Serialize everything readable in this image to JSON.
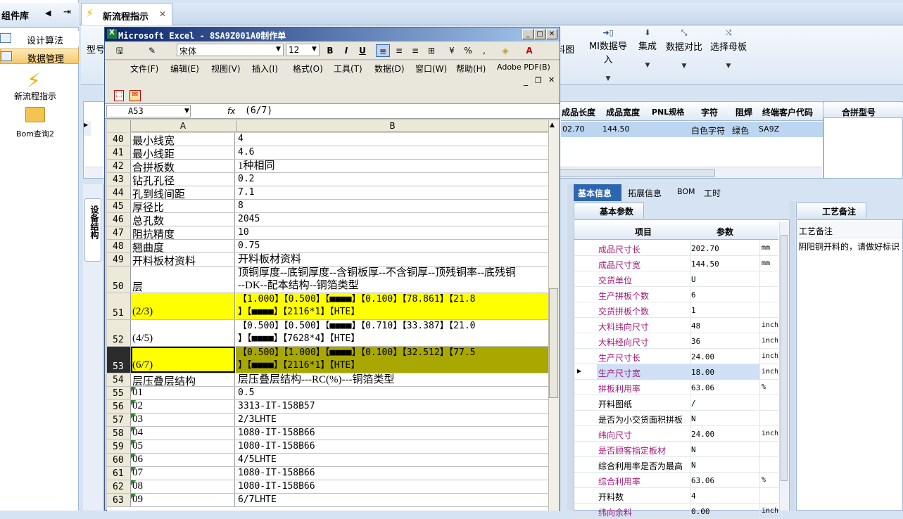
{
  "leftpanel": {
    "title": "组件库",
    "items": [
      "设计算法",
      "数据管理"
    ],
    "big_items": [
      "新流程指示",
      "Bom查询2"
    ]
  },
  "tabs": {
    "active": "新流程指示"
  },
  "ribbon": {
    "left_label": "型号",
    "partial_left": "料图",
    "buttons": [
      "MI数据导入",
      "集成",
      "数据对比",
      "选择母板"
    ]
  },
  "top_grid": {
    "headers": [
      "成品长度",
      "成品宽度",
      "PNL规格",
      "字符",
      "阻焊",
      "终端客户代码",
      "合拼型号"
    ],
    "row": [
      "02.70",
      "144.50",
      "",
      "白色字符",
      "绿色",
      "SA9Z"
    ]
  },
  "side_vtab": "设备结构",
  "right_tabs": [
    "基本信息",
    "拓展信息",
    "BOM",
    "工时"
  ],
  "basic": {
    "tab": "基本参数",
    "headers": [
      "项目",
      "参数"
    ],
    "rows": [
      {
        "name": "成品尺寸长",
        "value": "202.70",
        "unit": "mm"
      },
      {
        "name": "成品尺寸宽",
        "value": "144.50",
        "unit": "mm"
      },
      {
        "name": "交货单位",
        "value": "U",
        "unit": ""
      },
      {
        "name": "生产拼板个数",
        "value": "6",
        "unit": ""
      },
      {
        "name": "交货拼板个数",
        "value": "1",
        "unit": ""
      },
      {
        "name": "大料纬向尺寸",
        "value": "48",
        "unit": "inch"
      },
      {
        "name": "大料经向尺寸",
        "value": "36",
        "unit": "inch"
      },
      {
        "name": "生产尺寸长",
        "value": "24.00",
        "unit": "inch"
      },
      {
        "name": "生产尺寸宽",
        "value": "18.00",
        "unit": "inch"
      },
      {
        "name": "拼板利用率",
        "value": "63.06",
        "unit": "%"
      },
      {
        "name": "开料图纸",
        "value": "/",
        "unit": ""
      },
      {
        "name": "是否为小交货面积拼板",
        "value": "N",
        "unit": ""
      },
      {
        "name": "纬向尺寸",
        "value": "24.00",
        "unit": "inch"
      },
      {
        "name": "是否顾客指定板材",
        "value": "N",
        "unit": ""
      },
      {
        "name": "综合利用率是否为最高",
        "value": "N",
        "unit": ""
      },
      {
        "name": "综合利用率",
        "value": "63.06",
        "unit": "%"
      },
      {
        "name": "开料数",
        "value": "4",
        "unit": ""
      },
      {
        "name": "纬向余料",
        "value": "0.00",
        "unit": "inch"
      }
    ]
  },
  "craft": {
    "tab": "工艺备注",
    "header": "工艺备注",
    "text": "阴阳铜开料的，请做好标识"
  },
  "excel": {
    "title": "Microsoft Excel - 8SA9Z001A0制作单",
    "font": "宋体",
    "size": "12",
    "menu": [
      "文件(F)",
      "编辑(E)",
      "视图(V)",
      "插入(I)",
      "格式(O)",
      "工具(T)",
      "数据(D)",
      "窗口(W)",
      "帮助(H)",
      "Adobe PDF(B)"
    ],
    "namebox": "A53",
    "fx": "fx",
    "formula": "(6/7)",
    "cols": [
      "A",
      "B"
    ],
    "rows": [
      {
        "n": "40",
        "a": "最小线宽",
        "b": "4"
      },
      {
        "n": "41",
        "a": "最小线距",
        "b": "4.6"
      },
      {
        "n": "42",
        "a": "合拼板数",
        "b": "1种相同"
      },
      {
        "n": "43",
        "a": "钻孔孔径",
        "b": "0.2"
      },
      {
        "n": "44",
        "a": "孔到线间距",
        "b": "7.1"
      },
      {
        "n": "45",
        "a": "厚径比",
        "b": "8"
      },
      {
        "n": "46",
        "a": "总孔数",
        "b": "2045"
      },
      {
        "n": "47",
        "a": "阻抗精度",
        "b": "10"
      },
      {
        "n": "48",
        "a": "翘曲度",
        "b": "0.75"
      },
      {
        "n": "49",
        "a": "开料板材资料",
        "b": "开料板材资料"
      },
      {
        "n": "50",
        "a": "层",
        "b": "顶铜厚度--底铜厚度--含铜板厚--不含铜厚--顶残铜率--底残铜\n--DK--配本结构--铜箔类型"
      },
      {
        "n": "51",
        "a": "(2/3)",
        "b": "【1.000】【0.500】【■■■■】【0.100】【78.861】【21.8\n】【■■■■】【2116*1】【HTE】"
      },
      {
        "n": "52",
        "a": "(4/5)",
        "b": "【0.500】【0.500】【■■■■】【0.710】【33.387】【21.0\n】【■■■■】【7628*4】【HTE】"
      },
      {
        "n": "53",
        "a": "(6/7)",
        "b": "【0.500】【1.000】【■■■■】【0.100】【32.512】【77.5\n】【■■■■】【2116*1】【HTE】"
      },
      {
        "n": "54",
        "a": "层压叠层结构",
        "b": "层压叠层结构---RC(%)---铜箔类型"
      },
      {
        "n": "55",
        "a": "01",
        "b": "0.5"
      },
      {
        "n": "56",
        "a": "02",
        "b": "3313-IT-158B57"
      },
      {
        "n": "57",
        "a": "03",
        "b": "2/3LHTE"
      },
      {
        "n": "58",
        "a": "04",
        "b": "1080-IT-158B66"
      },
      {
        "n": "59",
        "a": "05",
        "b": "1080-IT-158B66"
      },
      {
        "n": "60",
        "a": "06",
        "b": "4/5LHTE"
      },
      {
        "n": "61",
        "a": "07",
        "b": "1080-IT-158B66"
      },
      {
        "n": "62",
        "a": "08",
        "b": "1080-IT-158B66"
      },
      {
        "n": "63",
        "a": "09",
        "b": "6/7LHTE"
      }
    ]
  },
  "colors": {
    "yellow": "#ffff00",
    "olive": "#a8a800",
    "rowsel": "#2c2c2c",
    "accent": "#2d66b0"
  }
}
